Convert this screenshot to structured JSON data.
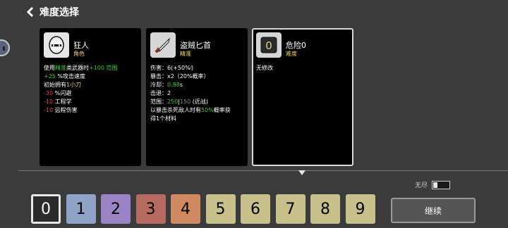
{
  "header": {
    "title": "难度选择"
  },
  "cards": [
    {
      "name": "狂人",
      "type": "角色",
      "lines": [
        {
          "parts": [
            {
              "t": "使用",
              "c": ""
            },
            {
              "t": "精准",
              "c": "g"
            },
            {
              "t": "类武器时",
              "c": ""
            },
            {
              "t": "+100 范围",
              "c": "g"
            }
          ]
        },
        {
          "parts": [
            {
              "t": "+25",
              "c": "g"
            },
            {
              "t": " %攻击速度",
              "c": ""
            }
          ]
        },
        {
          "parts": [
            {
              "t": "初始拥有",
              "c": ""
            },
            {
              "t": "1小刀",
              "c": "y"
            }
          ]
        },
        {
          "parts": [
            {
              "t": "-30",
              "c": "r"
            },
            {
              "t": " %闪避",
              "c": ""
            }
          ]
        },
        {
          "parts": [
            {
              "t": "-10",
              "c": "r"
            },
            {
              "t": " 工程学",
              "c": ""
            }
          ]
        },
        {
          "parts": [
            {
              "t": "-10",
              "c": "r"
            },
            {
              "t": " 远程伤害",
              "c": ""
            }
          ]
        }
      ]
    },
    {
      "name": "盗贼匕首",
      "type": "精准",
      "lines": [
        {
          "parts": [
            {
              "t": "伤害：6(+50%",
              "c": ""
            },
            {
              "t": "⁄",
              "c": "y"
            },
            {
              "t": ")",
              "c": ""
            }
          ]
        },
        {
          "parts": [
            {
              "t": "暴击：x2（20%概率）",
              "c": ""
            }
          ]
        },
        {
          "parts": [
            {
              "t": "冷却：",
              "c": ""
            },
            {
              "t": "0.88",
              "c": "g"
            },
            {
              "t": "s",
              "c": ""
            }
          ]
        },
        {
          "parts": [
            {
              "t": "击退：2",
              "c": ""
            }
          ]
        },
        {
          "parts": [
            {
              "t": "范围：",
              "c": ""
            },
            {
              "t": "250",
              "c": "g"
            },
            {
              "t": "|",
              "c": ""
            },
            {
              "t": "150",
              "c": "gr"
            },
            {
              "t": " (近战)",
              "c": ""
            }
          ]
        },
        {
          "parts": [
            {
              "t": "以暴击杀死敌人时有",
              "c": ""
            },
            {
              "t": "50%",
              "c": "g"
            },
            {
              "t": "概率获",
              "c": ""
            }
          ]
        },
        {
          "parts": [
            {
              "t": "得1个材料",
              "c": ""
            }
          ]
        }
      ]
    },
    {
      "name": "危险0",
      "type": "难度",
      "lines": [
        {
          "parts": [
            {
              "t": "无修改",
              "c": ""
            }
          ]
        }
      ]
    }
  ],
  "endless": {
    "label": "无尽",
    "enabled": false
  },
  "difficulties": [
    {
      "label": "0",
      "color": "#2b2b2b",
      "text_color": "#ffffff",
      "selected": true
    },
    {
      "label": "1",
      "color": "#8fa3c6",
      "selected": false
    },
    {
      "label": "2",
      "color": "#9a84c6",
      "selected": false
    },
    {
      "label": "3",
      "color": "#b66a62",
      "selected": false
    },
    {
      "label": "4",
      "color": "#d08a62",
      "selected": false
    },
    {
      "label": "5",
      "color": "#c8c08a",
      "selected": false
    },
    {
      "label": "6",
      "color": "#c8c08a",
      "selected": false
    },
    {
      "label": "7",
      "color": "#c8c08a",
      "selected": false
    },
    {
      "label": "8",
      "color": "#c8c08a",
      "selected": false
    },
    {
      "label": "9",
      "color": "#c8c08a",
      "selected": false
    }
  ],
  "continue_label": "继续"
}
